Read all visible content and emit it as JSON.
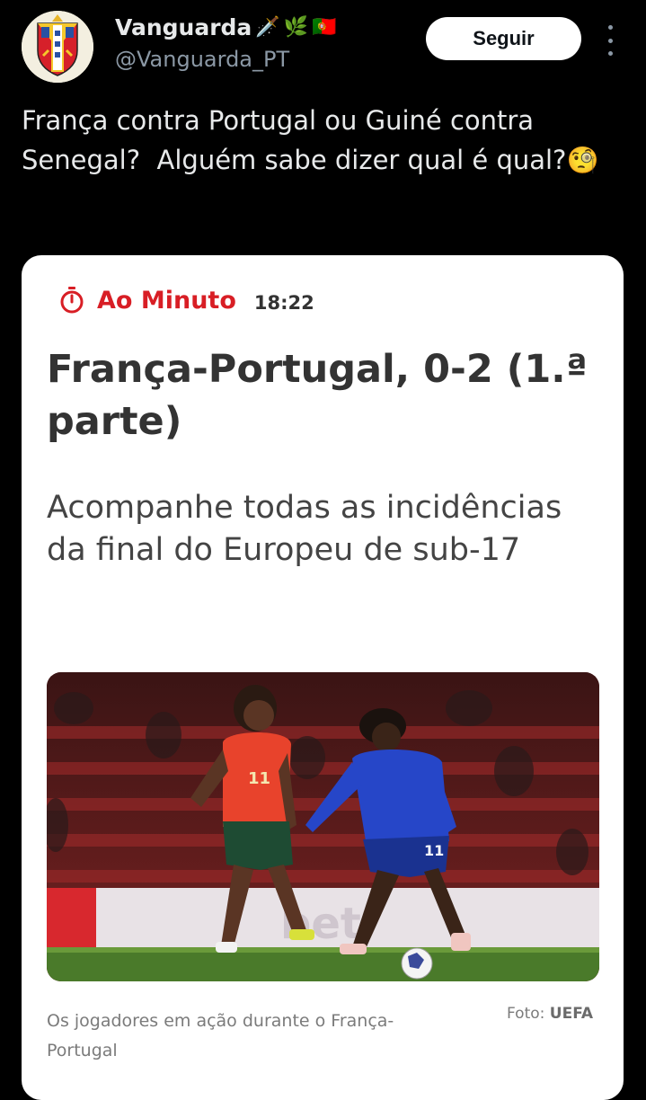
{
  "author": {
    "display_name": "Vanguarda",
    "name_emojis": [
      "🗡️",
      "🌿",
      "🇵🇹"
    ],
    "handle": "@Vanguarda_PT",
    "avatar_icon": "coat-of-arms-avatar"
  },
  "actions": {
    "follow_label": "Seguir",
    "more_icon": "more-vertical-icon"
  },
  "tweet": {
    "text": "França contra Portugal ou Guiné contra Senegal?  Alguém sabe dizer qual é qual?",
    "emoji": "🧐"
  },
  "card": {
    "kicker_label": "Ao Minuto",
    "kicker_icon": "stopwatch-icon",
    "time": "18:22",
    "headline": "França-Portugal, 0-2 (1.ª parte)",
    "subtitle": "Acompanhe todas as incidências da final do Europeu de sub-17",
    "caption": "Os jogadores em ação durante o França-Portugal",
    "credit_prefix": "Foto:",
    "credit_source": "UEFA",
    "photo_jersey_numbers": [
      "11",
      "11"
    ],
    "photo_board_text": "bet"
  },
  "colors": {
    "background": "#000000",
    "accent_red": "#d81e25",
    "card_bg": "#ffffff",
    "follow_bg": "#ffffff",
    "handle_gray": "#8b98a5"
  }
}
